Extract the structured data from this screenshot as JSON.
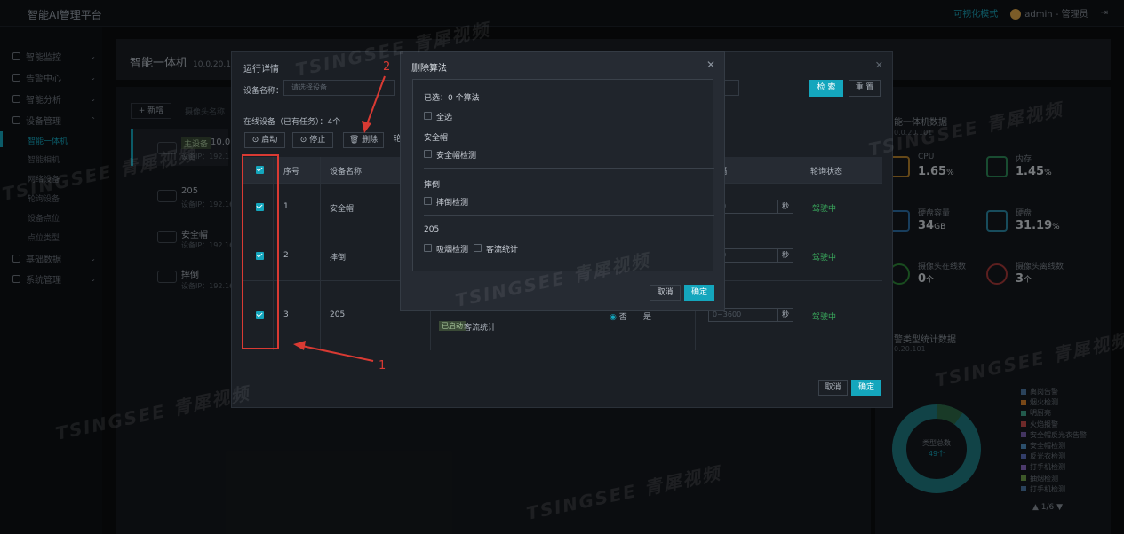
{
  "header": {
    "brand": "智能AI管理平台",
    "mode": "可视化模式",
    "user": "admin - 管理员"
  },
  "sidebar": {
    "items": [
      {
        "label": "智能监控"
      },
      {
        "label": "告警中心"
      },
      {
        "label": "智能分析"
      },
      {
        "label": "设备管理"
      },
      {
        "label": "基础数据"
      },
      {
        "label": "系统管理"
      }
    ],
    "sub_items": [
      "智能一体机",
      "智能相机",
      "网络设备",
      "轮询设备",
      "设备点位",
      "点位类型"
    ]
  },
  "page": {
    "title": "智能一体机",
    "ip": "10.0.20.101"
  },
  "left": {
    "add_label": "+ 新增",
    "add_cam_label": "摄像头名称",
    "main_tag": "主设备",
    "main_name": "10.0.2",
    "main_ip": "设备IP：192.1",
    "devices": [
      {
        "name": "205",
        "ip": "设备IP：192.16"
      },
      {
        "name": "安全帽",
        "ip": "设备IP：192.16"
      },
      {
        "name": "摔倒",
        "ip": "设备IP：192.16"
      }
    ]
  },
  "right": {
    "title": "能一体机数据",
    "sub": "0.0.20.101",
    "stats": [
      {
        "label": "CPU",
        "value": "1.65",
        "unit": "%"
      },
      {
        "label": "内存",
        "value": "1.45",
        "unit": "%"
      },
      {
        "label": "硬盘容量",
        "value": "34",
        "unit": "GB"
      },
      {
        "label": "硬盘",
        "value": "31.19",
        "unit": "%"
      },
      {
        "label": "摄像头在线数",
        "value": "0",
        "unit": "个"
      },
      {
        "label": "摄像头离线数",
        "value": "3",
        "unit": "个"
      }
    ],
    "alarm_title": "警类型统计数据",
    "alarm_sub": "0.20.101",
    "donut_label": "类型总数",
    "donut_value": "49个",
    "legend": [
      "离岗告警",
      "烟火检测",
      "明厨亮",
      "火焰报警",
      "安全帽反光衣告警",
      "安全帽检测",
      "反光衣检测",
      "打手机检测",
      "抽烟检测",
      "打手机检测"
    ],
    "legend_colors": [
      "#4e79a7",
      "#d9822b",
      "#3fa48a",
      "#c94b4b",
      "#7a5fb0",
      "#4f8fc4",
      "#5b6fc0",
      "#8a6bc4",
      "#6fa04b",
      "#4e79a7"
    ],
    "pager": "▲ 1/6 ▼",
    "donut": {
      "total": 49,
      "segments": [
        0.9,
        0.1
      ]
    }
  },
  "dialog1": {
    "title": "运行详情",
    "device_label": "设备名称：",
    "device_placeholder": "请选择设备",
    "search": "检 索",
    "reset": "重 置",
    "online": "在线设备（已有任务）：4个",
    "btn_start": "启动",
    "btn_stop": "停止",
    "btn_delete": "删除",
    "btn_more": "轮",
    "columns": [
      "序号",
      "设备名称",
      "隔",
      "轮询状态"
    ],
    "rows": [
      {
        "no": "1",
        "name": "安全帽",
        "interval": "500",
        "status": "驾驶中"
      },
      {
        "no": "2",
        "name": "摔倒",
        "interval": "500",
        "status": "驾驶中"
      },
      {
        "no": "3",
        "name": "205",
        "interval": "0~3600",
        "status": "驾驶中"
      }
    ],
    "sec": "秒",
    "algo_tag": "已启动",
    "algo_name": "客流统计",
    "radio_yes": "否",
    "radio_no": "是",
    "cancel": "取消",
    "ok": "确定"
  },
  "dialog2": {
    "title": "删除算法",
    "selected": "已选：0 个算法",
    "select_all": "全选",
    "groups": [
      {
        "title": "安全帽",
        "items": [
          "安全帽检测"
        ]
      },
      {
        "title": "摔倒",
        "items": [
          "摔倒检测"
        ]
      },
      {
        "title": "205",
        "items": [
          "吸烟检测",
          "客流统计"
        ]
      }
    ],
    "cancel": "取消",
    "ok": "确定"
  },
  "annotations": {
    "one": "1",
    "two": "2"
  },
  "watermark": "TSINGSEE 青犀视频"
}
